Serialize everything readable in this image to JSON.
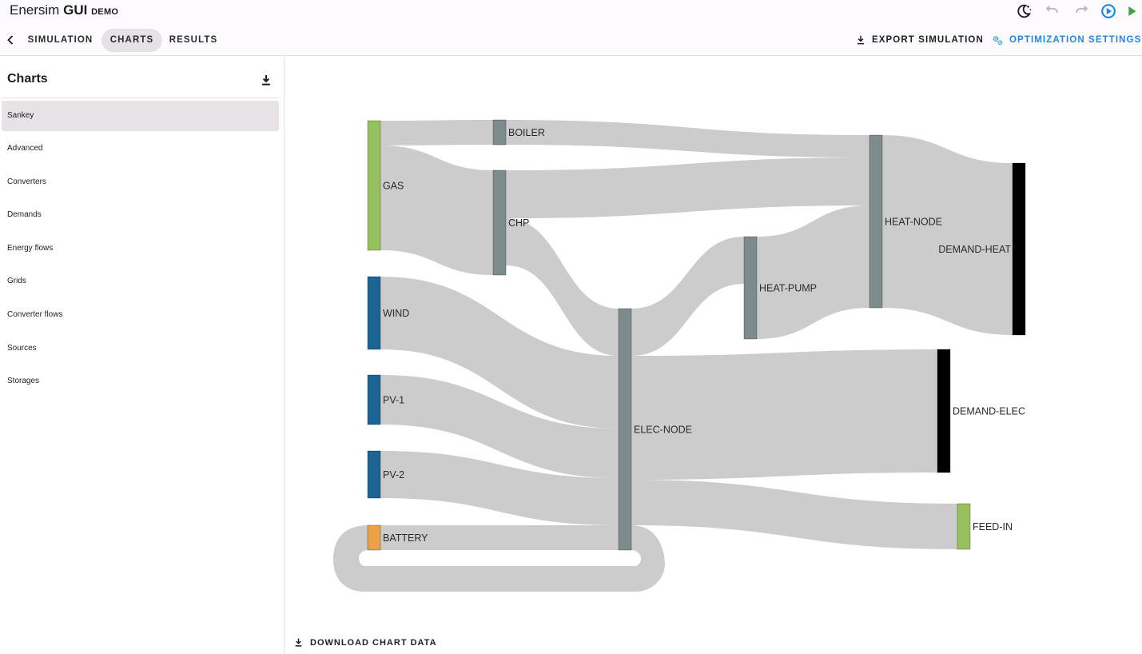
{
  "app": {
    "name": "Enersim",
    "name_bold": "GUI",
    "edition": "DEMO"
  },
  "toolbar_icons": [
    {
      "name": "dark-mode-icon",
      "color": "#1c1c1c"
    },
    {
      "name": "undo-icon",
      "color": "#b9b7bb"
    },
    {
      "name": "redo-icon",
      "color": "#b9b7bb"
    },
    {
      "name": "optimize-run-icon",
      "color": "#1e88e5"
    },
    {
      "name": "play-icon",
      "color": "#43a047"
    }
  ],
  "nav": {
    "tabs": [
      {
        "label": "SIMULATION",
        "active": false
      },
      {
        "label": "CHARTS",
        "active": true
      },
      {
        "label": "RESULTS",
        "active": false
      }
    ],
    "export_label": "EXPORT SIMULATION",
    "optimization_label": "OPTIMIZATION SETTINGS",
    "accent": "#1e88e5"
  },
  "sidebar": {
    "title": "Charts",
    "items": [
      {
        "label": "Sankey",
        "active": true
      },
      {
        "label": "Advanced",
        "active": false
      },
      {
        "label": "Converters",
        "active": false
      },
      {
        "label": "Demands",
        "active": false
      },
      {
        "label": "Energy flows",
        "active": false
      },
      {
        "label": "Grids",
        "active": false
      },
      {
        "label": "Converter flows",
        "active": false
      },
      {
        "label": "Sources",
        "active": false
      },
      {
        "label": "Storages",
        "active": false
      }
    ]
  },
  "main": {
    "download_label": "DOWNLOAD CHART DATA"
  },
  "chart_data": {
    "type": "sankey",
    "link_color": "#cccccc",
    "nodes": [
      {
        "id": "GAS",
        "color": "#97c15f"
      },
      {
        "id": "WIND",
        "color": "#1b6595"
      },
      {
        "id": "PV-1",
        "color": "#1b6595"
      },
      {
        "id": "PV-2",
        "color": "#1b6595"
      },
      {
        "id": "BATTERY",
        "color": "#eba146"
      },
      {
        "id": "BOILER",
        "color": "#7e8b8d"
      },
      {
        "id": "CHP",
        "color": "#7e8b8d"
      },
      {
        "id": "ELEC-NODE",
        "color": "#7e8b8d"
      },
      {
        "id": "HEAT-PUMP",
        "color": "#7e8b8d"
      },
      {
        "id": "HEAT-NODE",
        "color": "#7e8b8d"
      },
      {
        "id": "DEMAND-HEAT",
        "color": "#000000"
      },
      {
        "id": "DEMAND-ELEC",
        "color": "#000000"
      },
      {
        "id": "FEED-IN",
        "color": "#97c15f"
      }
    ],
    "links": [
      {
        "source": "GAS",
        "target": "BOILER",
        "value": 31
      },
      {
        "source": "GAS",
        "target": "CHP",
        "value": 130
      },
      {
        "source": "BOILER",
        "target": "HEAT-NODE",
        "value": 28
      },
      {
        "source": "CHP",
        "target": "HEAT-NODE",
        "value": 60
      },
      {
        "source": "CHP",
        "target": "ELEC-NODE",
        "value": 59
      },
      {
        "source": "WIND",
        "target": "ELEC-NODE",
        "value": 91
      },
      {
        "source": "PV-1",
        "target": "ELEC-NODE",
        "value": 62
      },
      {
        "source": "PV-2",
        "target": "ELEC-NODE",
        "value": 59
      },
      {
        "source": "BATTERY",
        "target": "ELEC-NODE",
        "value": 31
      },
      {
        "source": "ELEC-NODE",
        "target": "HEAT-PUMP",
        "value": 59
      },
      {
        "source": "ELEC-NODE",
        "target": "BATTERY",
        "value": 31
      },
      {
        "source": "ELEC-NODE",
        "target": "DEMAND-ELEC",
        "value": 153
      },
      {
        "source": "ELEC-NODE",
        "target": "FEED-IN",
        "value": 59
      },
      {
        "source": "HEAT-PUMP",
        "target": "HEAT-NODE",
        "value": 128
      },
      {
        "source": "HEAT-NODE",
        "target": "DEMAND-HEAT",
        "value": 216
      }
    ]
  }
}
